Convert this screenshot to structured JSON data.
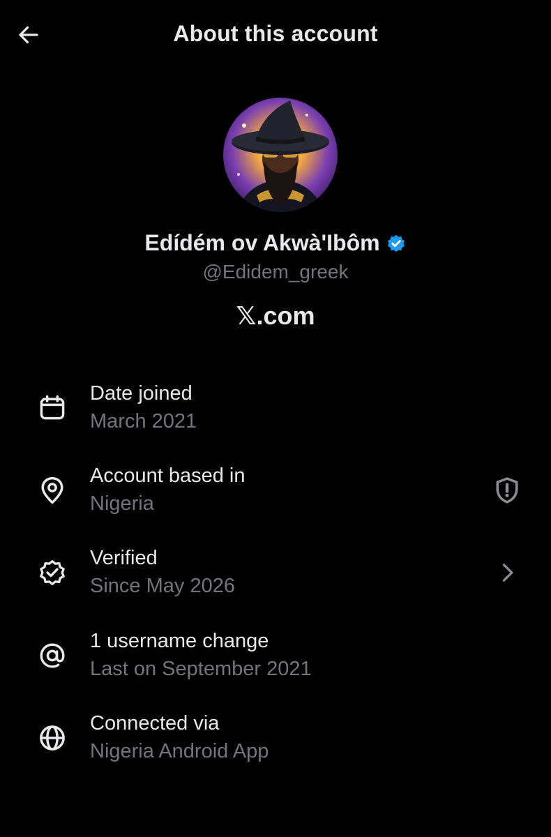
{
  "header": {
    "title": "About this account",
    "back_icon": "arrow-left-icon"
  },
  "profile": {
    "display_name": "Edídém ov Akwà'Ibôm",
    "handle": "@Edidem_greek",
    "verified": true,
    "verified_color": "#1d9bf0",
    "site_mark": "𝕏",
    "site_suffix": ".com"
  },
  "rows": [
    {
      "title": "Date joined",
      "subtitle": "March 2021",
      "icon": "calendar-icon"
    },
    {
      "title": "Account based in",
      "subtitle": "Nigeria",
      "icon": "location-pin-icon",
      "trailing_icon": "shield-alert-icon"
    },
    {
      "title": "Verified",
      "subtitle": "Since May 2026",
      "icon": "verified-badge-outline-icon",
      "trailing_icon": "chevron-right-icon"
    },
    {
      "title": "1 username change",
      "subtitle": "Last on September 2021",
      "icon": "at-sign-icon"
    },
    {
      "title": "Connected via",
      "subtitle": "Nigeria Android App",
      "icon": "globe-icon"
    }
  ],
  "colors": {
    "background": "#000000",
    "primary_text": "#e7e9ea",
    "secondary_text": "#71767b",
    "accent": "#1d9bf0"
  }
}
